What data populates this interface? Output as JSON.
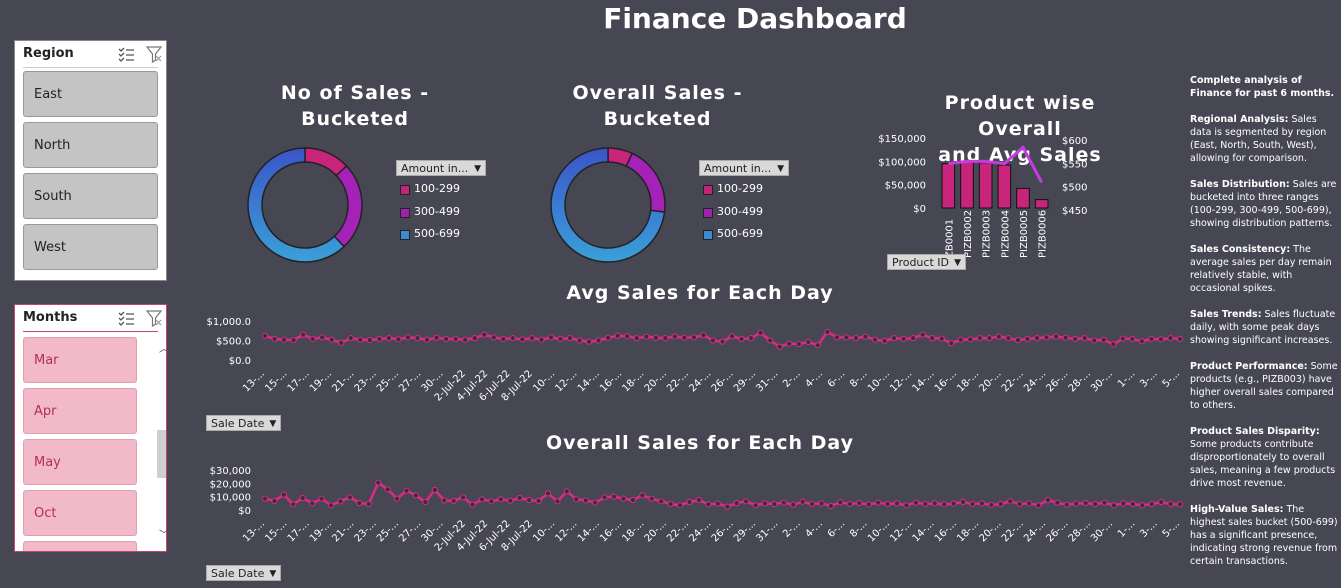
{
  "page": {
    "title": "Finance Dashboard"
  },
  "slicers": {
    "region": {
      "title": "Region",
      "items": [
        "East",
        "North",
        "South",
        "West"
      ]
    },
    "months": {
      "title": "Months",
      "items": [
        "Mar",
        "Apr",
        "May",
        "Oct"
      ]
    },
    "icons": {
      "multi_select": "multi-select-icon",
      "clear_filter": "clear-filter-icon"
    }
  },
  "donut_count": {
    "title_line1": "No of Sales -",
    "title_line2": "Bucketed",
    "filter_label": "Amount in...",
    "legend": [
      "100-299",
      "300-499",
      "500-699"
    ]
  },
  "donut_overall": {
    "title_line1": "Overall Sales -",
    "title_line2": "Bucketed",
    "filter_label": "Amount in...",
    "legend": [
      "100-299",
      "300-499",
      "500-699"
    ]
  },
  "product_chart": {
    "title_line1": "Product wise Overall",
    "title_line2": "and Avg Sales",
    "filter_label": "Product ID",
    "y_left_ticks": [
      "$150,000",
      "$100,000",
      "$50,000",
      "$0"
    ],
    "y_right_ticks": [
      "$600",
      "$550",
      "$500",
      "$450"
    ],
    "categories": [
      "ZB0001",
      "PIZB0002",
      "PIZB0003",
      "PIZB0004",
      "PIZB0005",
      "PIZB0006"
    ]
  },
  "avg_chart": {
    "title": "Avg Sales for Each Day",
    "filter_label": "Sale Date",
    "y_ticks": [
      "$1,000.0",
      "$500.0",
      "$0.0"
    ],
    "x_labels": [
      "13-...",
      "15-...",
      "17-...",
      "19-...",
      "21-...",
      "23-...",
      "25-...",
      "27-...",
      "30-...",
      "2-Jul-22",
      "4-Jul-22",
      "6-Jul-22",
      "8-Jul-22",
      "10-...",
      "12-...",
      "14-...",
      "16-...",
      "18-...",
      "20-...",
      "22-...",
      "24-...",
      "26-...",
      "29-...",
      "31-...",
      "2-...",
      "4-...",
      "6-...",
      "8-...",
      "10-...",
      "12-...",
      "14-...",
      "16-...",
      "18-...",
      "20-...",
      "22-...",
      "24-...",
      "26-...",
      "28-...",
      "30-...",
      "1-...",
      "3-...",
      "5-..."
    ]
  },
  "overall_chart": {
    "title": "Overall Sales for Each Day",
    "filter_label": "Sale Date",
    "y_ticks": [
      "$30,000",
      "$20,000",
      "$10,000",
      "$0"
    ],
    "x_labels": [
      "13-...",
      "15-...",
      "17-...",
      "19-...",
      "21-...",
      "23-...",
      "25-...",
      "27-...",
      "30-...",
      "2-Jul-22",
      "4-Jul-22",
      "6-Jul-22",
      "8-Jul-22",
      "10-...",
      "12-...",
      "14-...",
      "16-...",
      "18-...",
      "20-...",
      "22-...",
      "24-...",
      "26-...",
      "29-...",
      "31-...",
      "2-...",
      "4-...",
      "6-...",
      "8-...",
      "10-...",
      "12-...",
      "14-...",
      "16-...",
      "18-...",
      "20-...",
      "22-...",
      "24-...",
      "26-...",
      "28-...",
      "30-...",
      "1-...",
      "3-...",
      "5-..."
    ]
  },
  "notes": {
    "intro": "Complete analysis of Finance for past 6 months.",
    "items": [
      {
        "heading": "Regional Analysis:",
        "text": " Sales data is segmented by region (East, North, South, West), allowing for comparison."
      },
      {
        "heading": "Sales Distribution:",
        "text": " Sales are bucketed into three ranges (100-299, 300-499, 500-699), showing distribution patterns."
      },
      {
        "heading": "Sales Consistency:",
        "text": " The average sales per day remain relatively stable, with occasional spikes."
      },
      {
        "heading": "Sales Trends:",
        "text": " Sales fluctuate daily, with some peak days showing significant increases."
      },
      {
        "heading": "Product Performance:",
        "text": " Some products (e.g., PIZB003) have higher overall sales compared to others."
      },
      {
        "heading": "Product Sales Disparity:",
        "text": " Some products contribute disproportionately to overall sales, meaning a few products drive most revenue."
      },
      {
        "heading": "High-Value Sales:",
        "text": " The highest sales bucket (500-699) has a significant presence, indicating strong revenue from certain transactions."
      }
    ]
  },
  "chart_data": [
    {
      "type": "pie",
      "title": "No of Sales - Bucketed",
      "categories": [
        "100-299",
        "300-499",
        "500-699"
      ],
      "values": [
        13,
        25,
        62
      ],
      "colors": [
        "#c0257a",
        "#a020b0",
        "#3a6fd0"
      ]
    },
    {
      "type": "pie",
      "title": "Overall Sales - Bucketed",
      "categories": [
        "100-299",
        "300-499",
        "500-699"
      ],
      "values": [
        7,
        20,
        73
      ],
      "colors": [
        "#c0257a",
        "#a020b0",
        "#3a6fd0"
      ]
    },
    {
      "type": "bar",
      "title": "Product wise Overall and Avg Sales",
      "categories": [
        "ZB0001",
        "PIZB0002",
        "PIZB0003",
        "PIZB0004",
        "PIZB0005",
        "PIZB0006"
      ],
      "series": [
        {
          "values": [
            95000,
            100000,
            97000,
            92000,
            42000,
            18000
          ],
          "axis": "left",
          "kind": "bar"
        },
        {
          "values": [
            545,
            550,
            550,
            545,
            580,
            505
          ],
          "axis": "right",
          "kind": "line"
        }
      ],
      "ylim_left": [
        0,
        150000
      ],
      "ylim_right": [
        450,
        600
      ]
    },
    {
      "type": "line",
      "title": "Avg Sales for Each Day",
      "ylim": [
        0,
        1000
      ],
      "values": [
        620,
        540,
        520,
        510,
        650,
        540,
        580,
        520,
        440,
        560,
        520,
        510,
        540,
        560,
        530,
        580,
        560,
        520,
        570,
        540,
        540,
        520,
        560,
        650,
        580,
        540,
        560,
        530,
        560,
        520,
        580,
        540,
        560,
        500,
        470,
        500,
        570,
        620,
        610,
        560,
        600,
        570,
        560,
        600,
        570,
        580,
        640,
        500,
        470,
        610,
        540,
        560,
        700,
        500,
        340,
        420,
        410,
        460,
        380,
        720,
        580,
        580,
        560,
        600,
        520,
        490,
        560,
        540,
        560,
        650,
        560,
        550,
        430,
        520,
        530,
        560,
        560,
        600,
        560,
        510,
        540,
        560,
        580,
        600,
        570,
        540,
        560,
        500,
        520,
        400,
        550,
        540,
        480,
        540,
        530,
        560,
        540
      ]
    },
    {
      "type": "line",
      "title": "Overall Sales for Each Day",
      "ylim": [
        0,
        30000
      ],
      "values": [
        8500,
        6800,
        11500,
        4200,
        9000,
        5000,
        8500,
        3500,
        6500,
        9500,
        5200,
        4500,
        20500,
        15500,
        8500,
        14500,
        11000,
        6000,
        15000,
        7200,
        6800,
        9500,
        4000,
        8000,
        6500,
        8000,
        7000,
        9000,
        7500,
        6800,
        12500,
        6500,
        14000,
        8000,
        7200,
        5500,
        9500,
        10000,
        8500,
        7500,
        11000,
        8500,
        6500,
        4500,
        3500,
        6000,
        7500,
        4200,
        4800,
        2500,
        5200,
        6500,
        3500,
        5000,
        4500,
        5500,
        4000,
        6200,
        4500,
        5000,
        3000,
        5800,
        4500,
        5200,
        4200,
        5500,
        4500,
        5000,
        3500,
        5500,
        4500,
        5000,
        4200,
        4800,
        6000,
        4500,
        5000,
        3800,
        4500,
        6500,
        4500,
        5000,
        3500,
        7500,
        5500,
        4000,
        4800,
        5200,
        4500,
        5500,
        3500,
        5000,
        4500,
        3500,
        4500,
        6000,
        4500,
        4200
      ]
    }
  ]
}
